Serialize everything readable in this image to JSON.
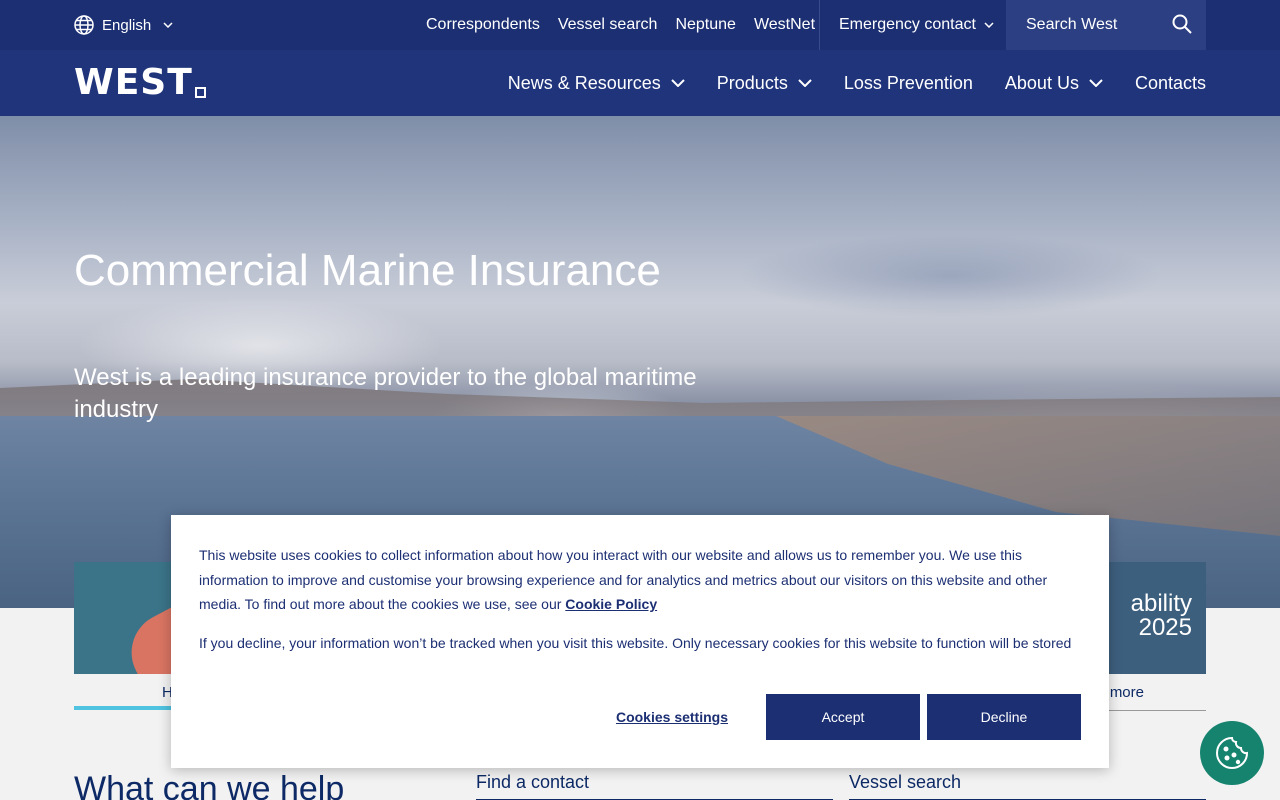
{
  "topbar": {
    "language": "English",
    "links": [
      "Correspondents",
      "Vessel search",
      "Neptune",
      "WestNet"
    ],
    "emergency": "Emergency contact",
    "search_placeholder": "Search West"
  },
  "nav": {
    "logo": "WEST",
    "items": [
      "News & Resources",
      "Products",
      "Loss Prevention",
      "About Us",
      "Contacts"
    ]
  },
  "hero": {
    "title": "Commercial Marine Insurance",
    "subtitle": "West is a leading insurance provider to the global maritime industry"
  },
  "cards": {
    "left_label": "H",
    "right_image_text": "ability\n2025",
    "right_label": "more"
  },
  "help": {
    "title": "What can we help",
    "find_contact": "Find a contact",
    "vessel_search": "Vessel search"
  },
  "cookie": {
    "text1": "This website uses cookies to collect information about how you interact with our website and allows us to remember you. We use this information to improve and customise your browsing experience and for analytics and metrics about our visitors on this website and other media. To find out more about the cookies we use, see our",
    "policy_link": "Cookie Policy",
    "text2": "If you decline, your information won’t be tracked when you visit this website. Only necessary cookies for this website to function will be stored",
    "settings": "Cookies settings",
    "accept": "Accept",
    "decline": "Decline"
  },
  "colors": {
    "topbar": "#1c2f73",
    "nav": "#1f347a",
    "accent": "#4fc3e0",
    "fab": "#16836f"
  }
}
